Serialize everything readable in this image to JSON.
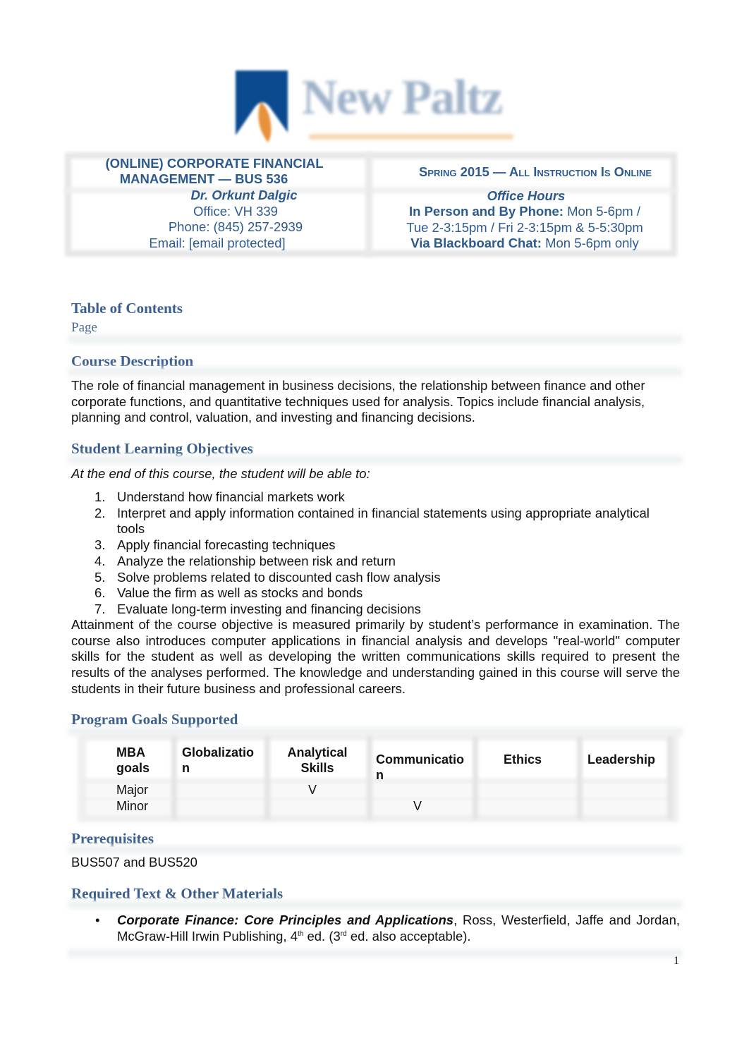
{
  "logo": {
    "wordmark": "New Paltz",
    "brand_blue": "#0b4a8f",
    "brand_orange": "#e8913a"
  },
  "header": {
    "course_title_line1": "(ONLINE) CORPORATE FINANCIAL",
    "course_title_line2": "MANAGEMENT —  BUS 536",
    "instructor": "Dr. Orkunt Dalgic",
    "office": "Office:  VH 339",
    "phone": "Phone: (845) 257-2939",
    "email_label": "Email:  ",
    "email_value": "[email protected]",
    "term": "Spring 2015 — All Instruction Is Online",
    "office_hours_title": "Office Hours",
    "in_person_label": "In Person and By Phone:",
    "in_person_hours_1": " Mon 5-6pm  /",
    "in_person_hours_2": "Tue 2-3:15pm  / Fri 2-3:15pm & 5-5:30pm",
    "chat_label": "Via Blackboard Chat:",
    "chat_hours": " Mon 5-6pm only"
  },
  "toc": {
    "title": "Table of Contents",
    "page_label": "Page"
  },
  "course_description": {
    "title": "Course Description",
    "text": "The role of financial management in business decisions, the relationship between finance and other corporate functions, and quantitative techniques used for analysis. Topics include financial analysis, planning and control, valuation, and investing and financing decisions."
  },
  "objectives": {
    "title": "Student Learning Objectives",
    "intro": "At the end of this course, the student will be able to:",
    "items": [
      {
        "num": "1.",
        "text": "Understand how financial markets work"
      },
      {
        "num": "2.",
        "text": " Interpret and apply information contained in financial statements using appropriate analytical tools"
      },
      {
        "num": "3.",
        "text": "Apply financial forecasting techniques"
      },
      {
        "num": "4.",
        "text": "Analyze the relationship between risk and return"
      },
      {
        "num": "5.",
        "text": "Solve problems related to discounted cash flow analysis"
      },
      {
        "num": "6.",
        "text": "Value the firm as well as stocks and bonds"
      },
      {
        "num": "7.",
        "text": "Evaluate long-term investing and financing decisions"
      }
    ],
    "attainment": "Attainment of the course objective is measured primarily by student’s performance in examination. The course also introduces computer applications in financial analysis and develops \"real-world\" computer skills for the student as well as developing the written communications skills required to present the results of the analyses performed.  The knowledge and understanding gained in this course will serve the students in their future business and professional careers."
  },
  "program_goals": {
    "title": "Program Goals Supported",
    "headers": [
      "MBA goals",
      "Globalization",
      "Analytical Skills",
      "Communication",
      "Ethics",
      "Leadership"
    ],
    "rows": [
      {
        "label": "Major",
        "cells": [
          "",
          "V",
          "",
          "",
          ""
        ]
      },
      {
        "label": "Minor",
        "cells": [
          "",
          "",
          "V",
          "",
          ""
        ]
      }
    ]
  },
  "prerequisites": {
    "title": "Prerequisites",
    "text": "BUS507 and BUS520"
  },
  "materials": {
    "title": "Required Text & Other Materials",
    "items": [
      {
        "book_title": "Corporate Finance: Core Principles and Applications",
        "rest_1": ", Ross, Westerfield, Jaffe and Jordan, McGraw-Hill Irwin Publishing, 4",
        "sup_1": "th",
        "rest_2": " ed. (3",
        "sup_2": "rd",
        "rest_3": " ed. also acceptable)."
      }
    ]
  },
  "footer": {
    "page_number": "1"
  }
}
